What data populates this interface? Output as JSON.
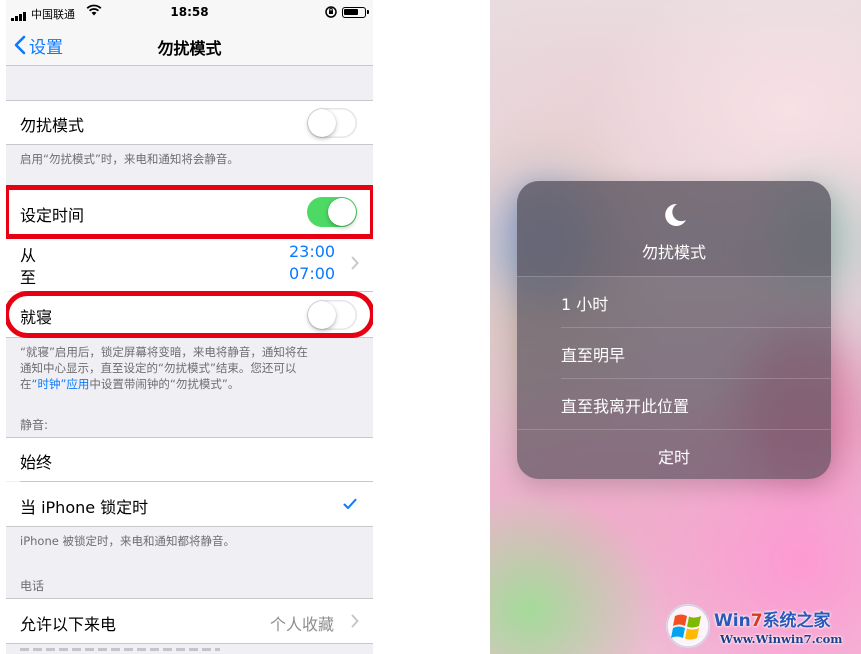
{
  "status_bar": {
    "carrier": "中国联通",
    "time": "18:58"
  },
  "nav": {
    "back_label": "设置",
    "title": "勿扰模式"
  },
  "dnd_row": {
    "label": "勿扰模式",
    "toggle_on": false
  },
  "dnd_footnote": "启用“勿扰模式”时，来电和通知将会静音。",
  "scheduled_row": {
    "label": "设定时间",
    "toggle_on": true
  },
  "schedule": {
    "from_label": "从",
    "to_label": "至",
    "from_time": "23:00",
    "to_time": "07:00"
  },
  "bedtime_row": {
    "label": "就寝",
    "toggle_on": false
  },
  "bedtime_footnote": {
    "line1": "“就寝”启用后，锁定屏幕将变暗，来电将静音，通知将在",
    "line2": "通知中心显示，直至设定的“勿扰模式”结束。您还可以",
    "line3_prefix": "在",
    "line3_link": "“时钟”应用",
    "line3_suffix": "中设置带闹钟的“勿扰模式”。"
  },
  "silence_header": "静音:",
  "silence_options": {
    "always": "始终",
    "locked": "当 iPhone 锁定时",
    "selected": "locked"
  },
  "silence_footnote": "iPhone 被锁定时，来电和通知都将静音。",
  "phone_header": "电话",
  "allow_calls": {
    "label": "允许以下来电",
    "value": "个人收藏"
  },
  "dnd_card": {
    "title": "勿扰模式",
    "options": [
      "1 小时",
      "直至明早",
      "直至我离开此位置"
    ],
    "schedule_label": "定时"
  },
  "watermark": {
    "brand_prefix": "Win",
    "brand_seven": "7",
    "brand_suffix": "系统之家",
    "url": "Www.Winwin7.com"
  },
  "colors": {
    "accent": "#0a7aff",
    "toggle_on": "#4cd964",
    "highlight": "#e60012"
  }
}
